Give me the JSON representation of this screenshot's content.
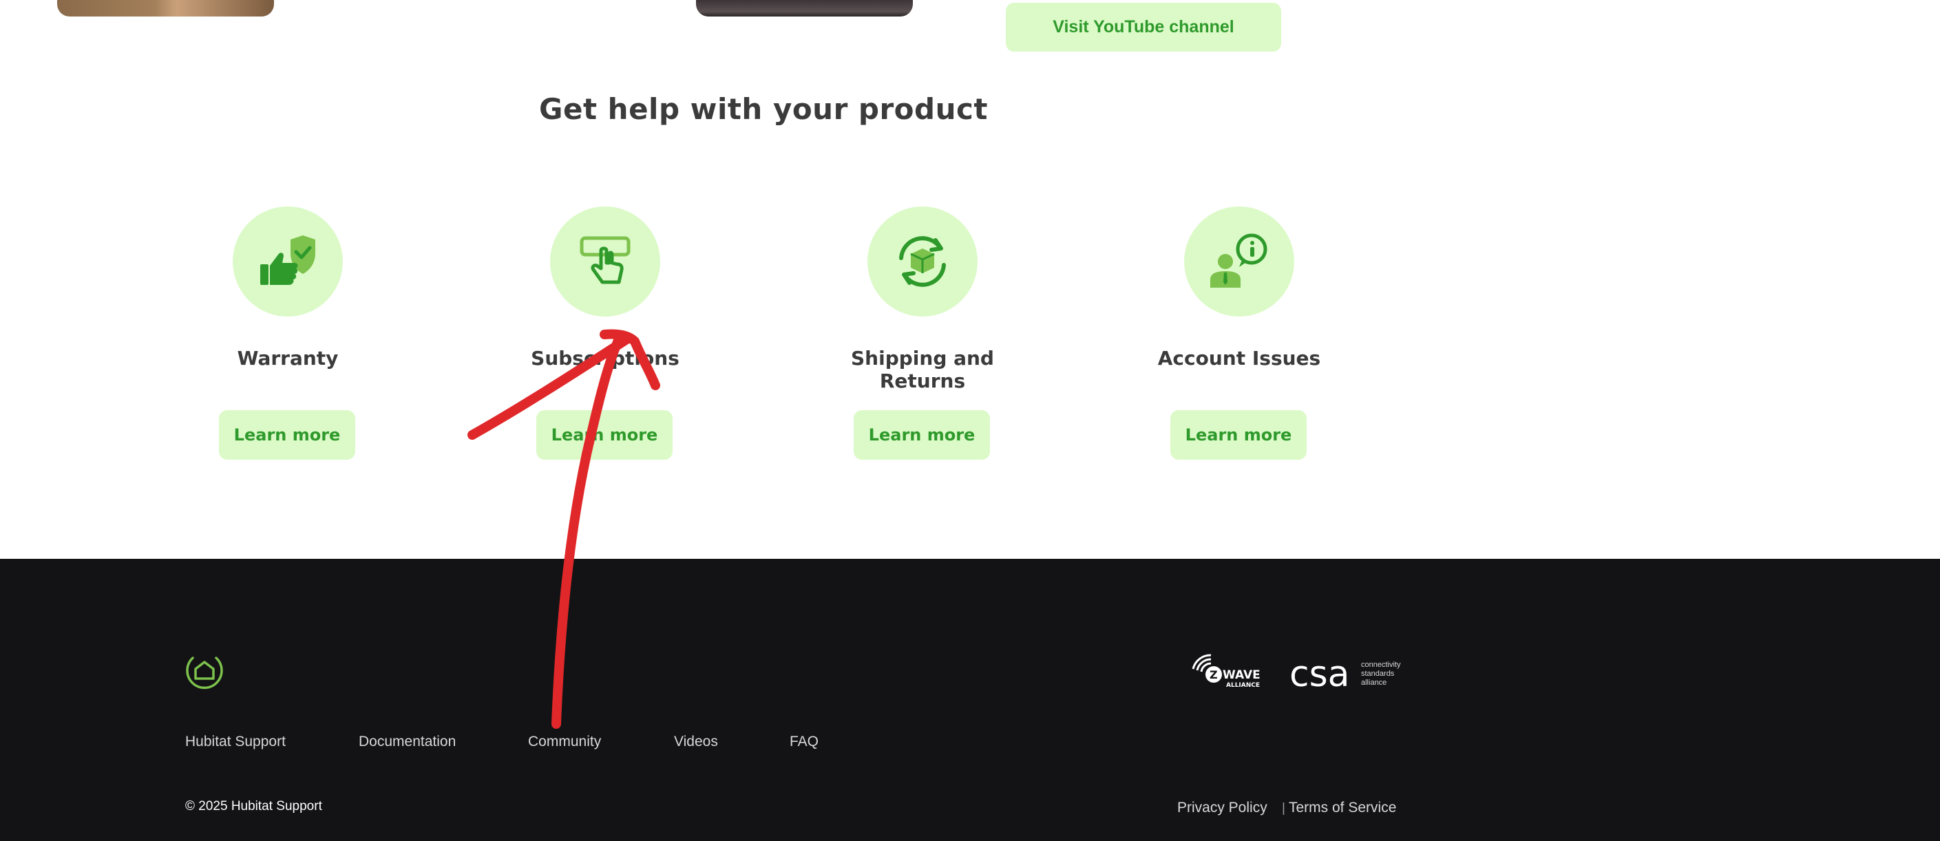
{
  "top": {
    "youtube_button": "Visit YouTube channel"
  },
  "help": {
    "title": "Get help with your product",
    "cards": [
      {
        "label": "Warranty",
        "button": "Learn more"
      },
      {
        "label": "Subscriptions",
        "button": "Learn more"
      },
      {
        "label": "Shipping and Returns",
        "button": "Learn more"
      },
      {
        "label": "Account Issues",
        "button": "Learn more"
      }
    ]
  },
  "footer": {
    "links": [
      "Hubitat Support",
      "Documentation",
      "Community",
      "Videos",
      "FAQ"
    ],
    "copyright": "© 2025 Hubitat Support",
    "privacy": "Privacy Policy",
    "separator": "|",
    "terms": "Terms of Service",
    "badges": {
      "zwave_main": "WAVE",
      "zwave_sub": "ALLIANCE",
      "csa_main": "csa",
      "csa_lines": [
        "connectivity",
        "standards",
        "alliance"
      ]
    }
  },
  "colors": {
    "accent_green": "#2f9a2c",
    "pale_green": "#dcfac8",
    "footer_bg": "#131315",
    "annotation_red": "#e0282a"
  },
  "icons": [
    "thumbs-up-shield-icon",
    "tap-button-icon",
    "box-cycle-icon",
    "person-info-icon",
    "home-logo-icon"
  ]
}
